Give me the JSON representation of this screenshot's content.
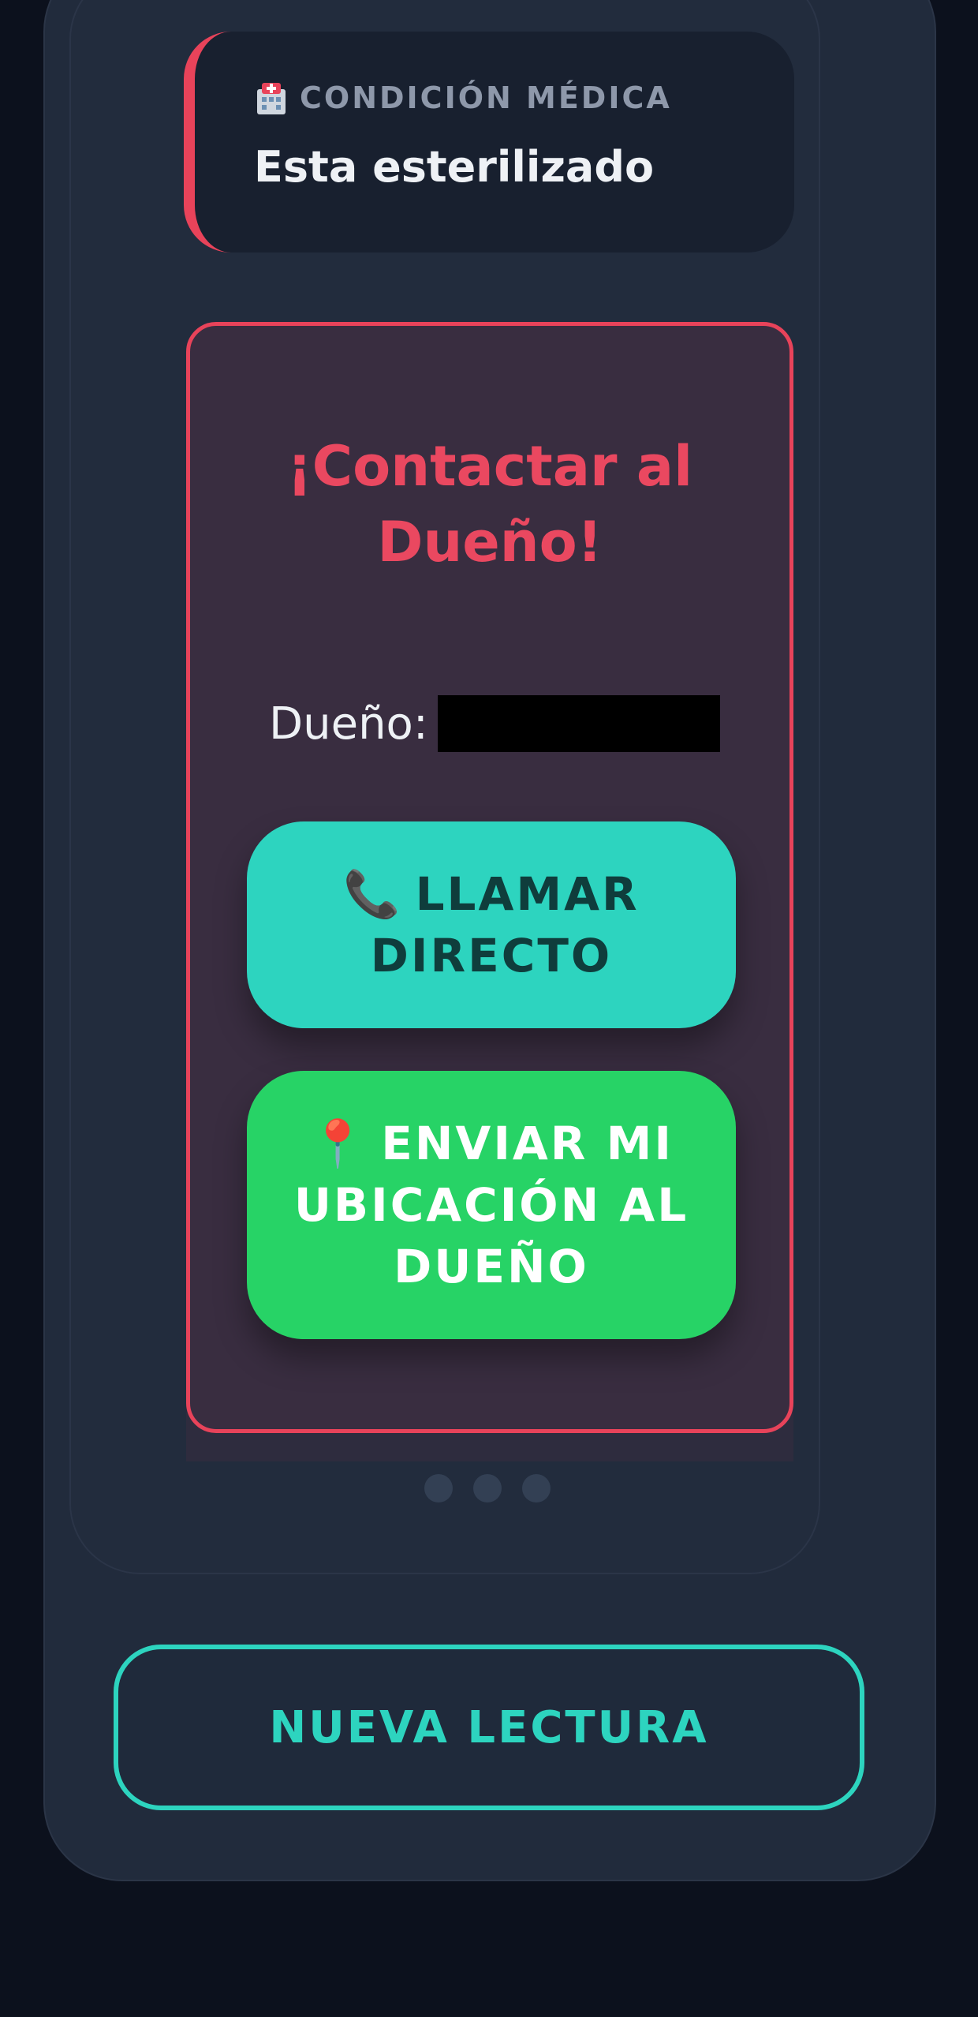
{
  "medical": {
    "label": "CONDICIÓN MÉDICA",
    "value": "Esta esterilizado",
    "icon": "hospital-icon"
  },
  "contact": {
    "title": "¡Contactar al Dueño!",
    "owner_label": "Dueño:",
    "call_icon": "📞",
    "call_label": "LLAMAR DIRECTO",
    "location_icon": "📍",
    "location_label": "ENVIAR MI UBICACIÓN AL DUEÑO"
  },
  "carousel": {
    "dots": 3
  },
  "footer": {
    "new_reading_label": "NUEVA LECTURA"
  },
  "colors": {
    "accent_red": "#e8435a",
    "accent_teal": "#2dd4bf",
    "accent_green": "#27d366",
    "background": "#0c111d",
    "panel": "#212b3c"
  }
}
